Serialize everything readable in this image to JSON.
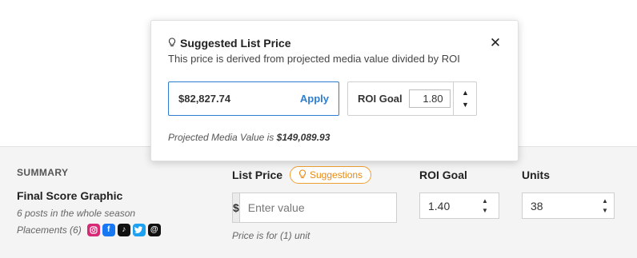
{
  "summary": {
    "heading": "SUMMARY",
    "item_title": "Final Score Graphic",
    "posts_note": "6 posts in the whole season",
    "placements_label": "Placements (6)",
    "social_icons": [
      "instagram-icon",
      "facebook-icon",
      "tiktok-icon",
      "twitter-icon",
      "threads-icon"
    ]
  },
  "list_price": {
    "label": "List Price",
    "suggestions_label": "Suggestions",
    "currency_symbol": "$",
    "placeholder": "Enter value",
    "note": "Price is for (1) unit"
  },
  "roi_goal": {
    "label": "ROI Goal",
    "value": "1.40"
  },
  "units": {
    "label": "Units",
    "value": "38"
  },
  "popover": {
    "title": "Suggested List Price",
    "subtitle": "This price is derived from projected media value divided by ROI",
    "suggested_value": "$82,827.74",
    "apply_label": "Apply",
    "roi_label": "ROI Goal",
    "roi_value": "1.80",
    "pmv_prefix": "Projected Media Value is",
    "pmv_value": "$149,089.93",
    "close_glyph": "✕"
  },
  "colors": {
    "accent_blue": "#2f7dd1",
    "suggestion_orange": "#e88a12",
    "summary_bg": "#f4f4f4"
  }
}
